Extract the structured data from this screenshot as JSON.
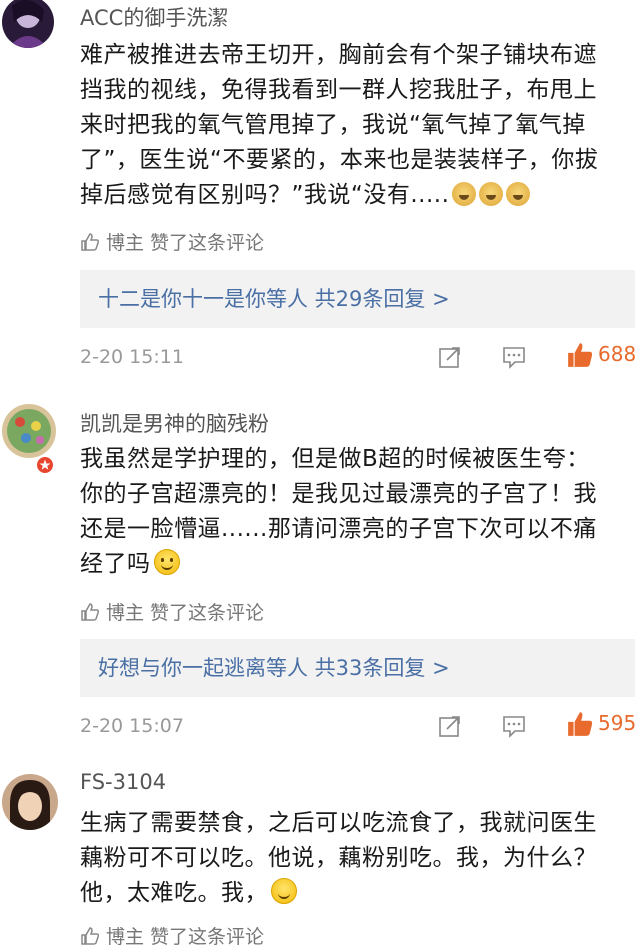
{
  "comments": [
    {
      "username": "ACC的御手洗潔",
      "lines": [
        "难产被推进去帝王切开，胸前会有个架子铺块布遮",
        "挡我的视线，免得我看到一群人挖我肚子，布甩上",
        "来时把我的氧气管甩掉了，我说“氧气掉了氧气掉",
        "了”，医生说“不要紧的，本来也是装装样子，你拔",
        "掉后感觉有区别吗？”我说“没有....."
      ],
      "emoji": "doge",
      "author_liked": "博主 赞了这条评论",
      "replies": "十二是你十一是你等人 共29条回复 >",
      "time": "2-20 15:11",
      "likes": "688"
    },
    {
      "username": "凯凯是男神的脑残粉",
      "lines": [
        "我虽然是学护理的，但是做B超的时候被医生夸：",
        "你的子宫超漂亮的！是我见过最漂亮的子宫了！我",
        "还是一脸懵逼......那请问漂亮的子宫下次可以不痛",
        "经了吗"
      ],
      "emoji": "smile",
      "author_liked": "博主 赞了这条评论",
      "replies": "好想与你一起逃离等人 共33条回复 >",
      "time": "2-20 15:07",
      "likes": "595"
    },
    {
      "username": "FS-3104",
      "lines": [
        "生病了需要禁食，之后可以吃流食了，我就问医生",
        "藕粉可不可以吃。他说，藕粉别吃。我，为什么？",
        "他，太难吃。我，"
      ],
      "emoji": "sweat",
      "author_liked": "博主 赞了这条评论"
    }
  ],
  "icons": {
    "share": "share-icon",
    "reply": "comment-icon",
    "like": "thumbs-up-icon",
    "author_like": "thumbs-up-outline-icon"
  },
  "colors": {
    "link": "#4a6fa5",
    "like": "#e86a2c",
    "reply_bg": "#f2f2f2"
  }
}
